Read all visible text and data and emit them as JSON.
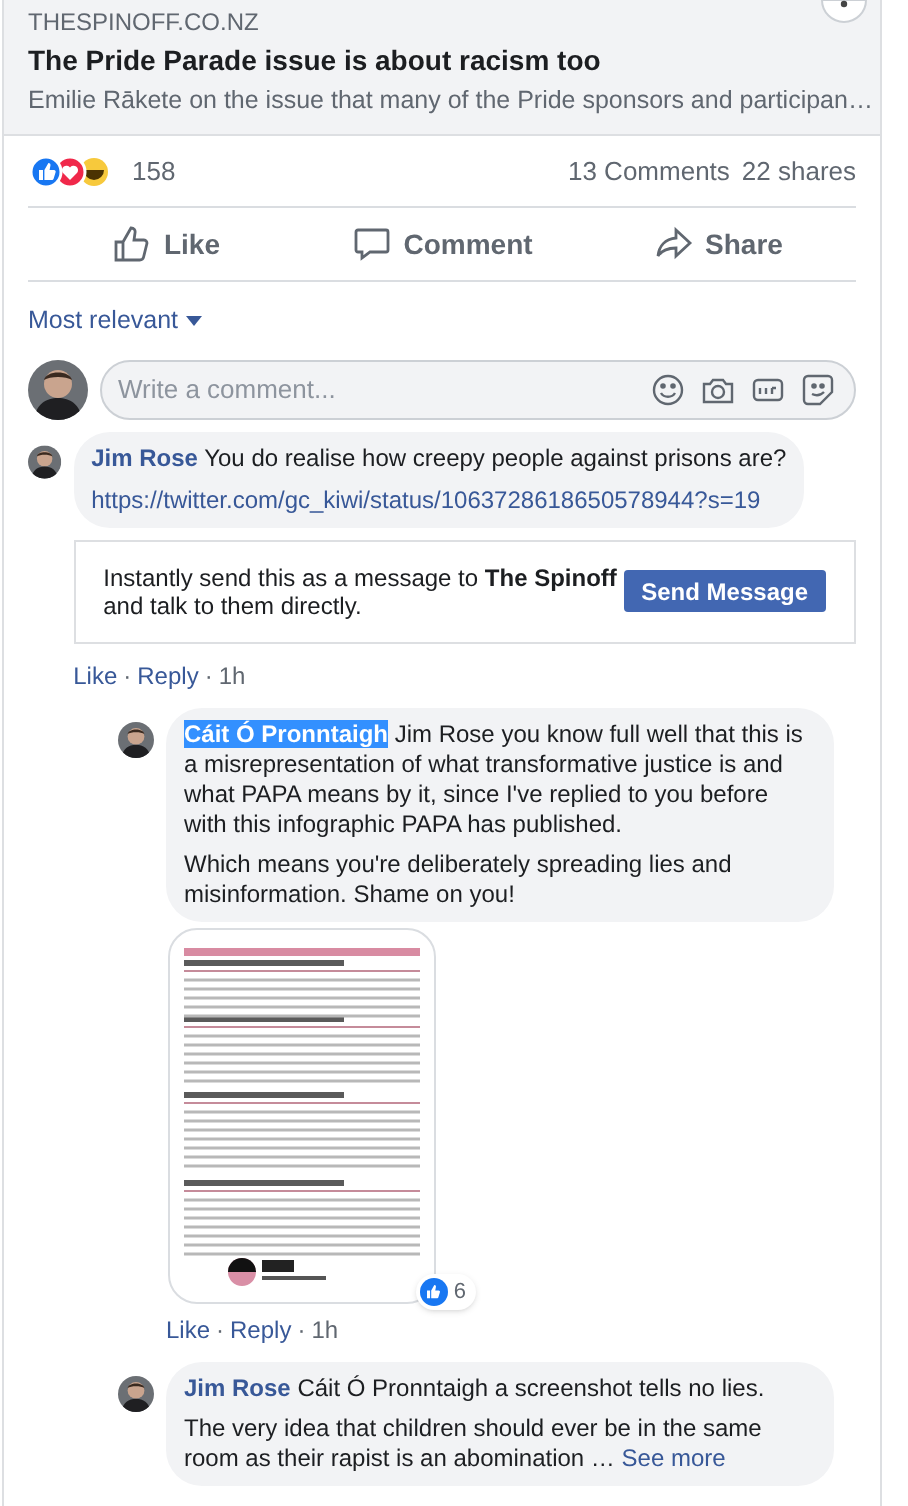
{
  "link_preview": {
    "domain": "THESPINOFF.CO.NZ",
    "title": "The Pride Parade issue is about racism too",
    "description": "Emilie Rākete on the issue that many of the Pride sponsors and participan…"
  },
  "reactions": {
    "count": "158",
    "comments": "13 Comments",
    "shares": "22 shares"
  },
  "actions": [
    {
      "kind": "like",
      "label": "Like"
    },
    {
      "kind": "comment",
      "label": "Comment"
    },
    {
      "kind": "share",
      "label": "Share"
    }
  ],
  "sort": {
    "label": "Most relevant"
  },
  "composer": {
    "placeholder": "Write a comment..."
  },
  "comments": [
    {
      "author": "Jim Rose",
      "author_selected": false,
      "paragraphs": [
        "You do realise how creepy people against prisons are?"
      ],
      "link": "https://twitter.com/gc_kiwi/status/1063728618650578944?s=19",
      "message_prompt": {
        "text": "Instantly send this as a message to **The Spinoff** and talk to them directly.",
        "button": "Send Message"
      },
      "meta": [
        {
          "kind": "link",
          "text": "Like"
        },
        {
          "kind": "separator",
          "text": "·"
        },
        {
          "kind": "link",
          "text": "Reply"
        },
        {
          "kind": "separator",
          "text": "·"
        },
        {
          "kind": "time",
          "text": "1h"
        }
      ],
      "replies": [
        {
          "author": "Cáit Ó Pronntaigh",
          "author_selected": true,
          "paragraphs": [
            "Jim Rose you know full well that this is a misrepresentation of what transformative justice is and what PAPA means by it, since I've replied to you before with this infographic PAPA has published.",
            "Which means you're deliberately spreading lies and misinformation. Shame on you!"
          ],
          "attachment": {
            "kind": "picture"
          },
          "like_count": "6",
          "meta": [
            {
              "kind": "link",
              "text": "Like"
            },
            {
              "kind": "separator",
              "text": "·"
            },
            {
              "kind": "link",
              "text": "Reply"
            },
            {
              "kind": "separator",
              "text": "·"
            },
            {
              "kind": "time",
              "text": "1h"
            }
          ]
        },
        {
          "author": "Jim Rose",
          "author_selected": false,
          "paragraphs": [
            "Cáit Ó Pronntaigh a screenshot tells no lies.",
            "The very idea that children should ever be in the same room as their rapist is an abomination …"
          ],
          "see_more": "See more"
        }
      ]
    }
  ]
}
